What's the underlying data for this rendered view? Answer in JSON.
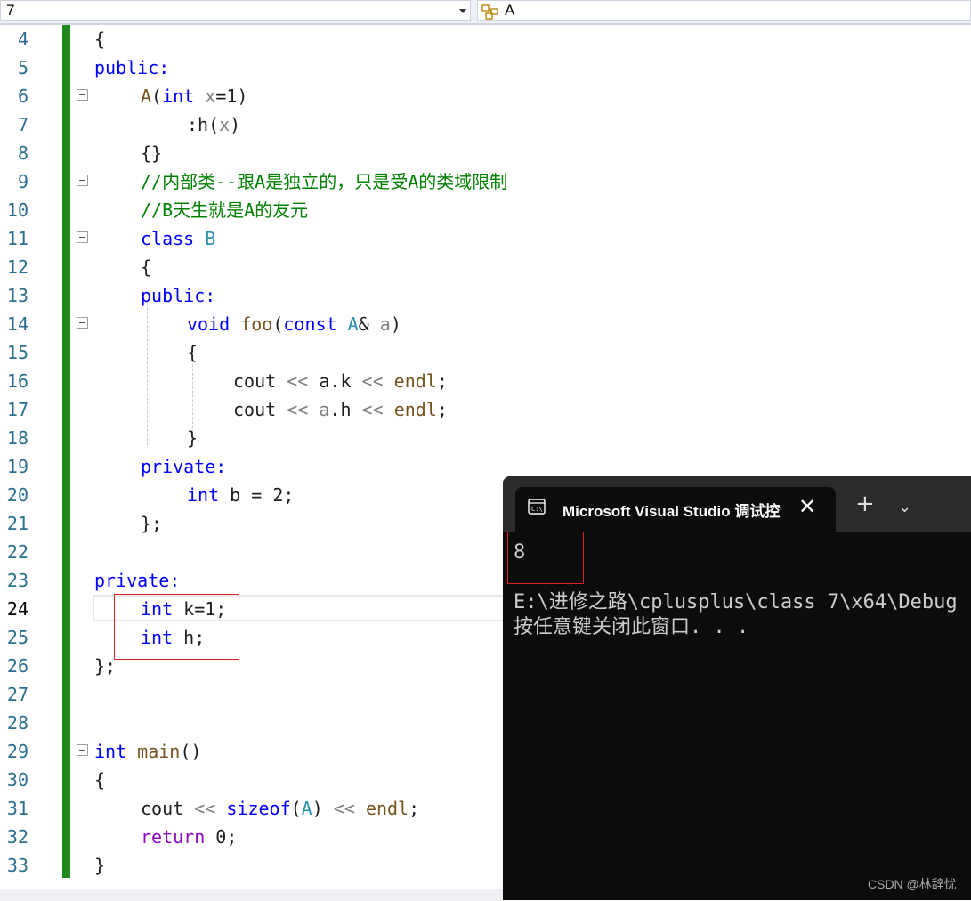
{
  "navbar": {
    "left_dropdown_value": "7",
    "right_dropdown_value": "A",
    "right_icon": "class-icon"
  },
  "editor": {
    "line_numbers": [
      "4",
      "5",
      "6",
      "7",
      "8",
      "9",
      "10",
      "11",
      "12",
      "13",
      "14",
      "15",
      "16",
      "17",
      "18",
      "19",
      "20",
      "21",
      "22",
      "23",
      "24",
      "25",
      "26",
      "27",
      "28",
      "29",
      "30",
      "31",
      "32",
      "33"
    ],
    "lines": {
      "l4": "{",
      "l5": "public:",
      "l6_name": "A",
      "l6_open": "(",
      "l6_kw": "int",
      "l6_param": "x",
      "l6_rest": "=1)",
      "l7_a": ":h(",
      "l7_b": "x",
      "l7_c": ")",
      "l8": "{}",
      "l9": "//内部类--跟A是独立的，只是受A的类域限制",
      "l10": "//B天生就是A的友元",
      "l11_kw": "class",
      "l11_name": "B",
      "l12": "{",
      "l13": "public:",
      "l14_kw": "void",
      "l14_fn": "foo",
      "l14_open": "(",
      "l14_const": "const",
      "l14_type": "A",
      "l14_amp": "&",
      "l14_param": "a",
      "l14_close": ")",
      "l15": "{",
      "l16_a": "cout",
      "l16_b": "<<",
      "l16_c": "a.k",
      "l16_d": "<<",
      "l16_e": "endl",
      "l16_f": ";",
      "l17_a": "cout",
      "l17_b": "<<",
      "l17_c": "a",
      "l17_d": ".h",
      "l17_e": "<<",
      "l17_f": "endl",
      "l17_g": ";",
      "l18": "}",
      "l19": "private:",
      "l20_kw": "int",
      "l20_rest": "b = 2;",
      "l21": "};",
      "l23": "private:",
      "l24_kw": "int",
      "l24_rest": "k=1;",
      "l25_kw": "int",
      "l25_rest": "h;",
      "l26": "};",
      "l29_kw": "int",
      "l29_fn": "main",
      "l29_rest": "()",
      "l30": "{",
      "l31_a": "cout",
      "l31_b": "<<",
      "l31_c": "sizeof",
      "l31_d": "(",
      "l31_e": "A",
      "l31_f": ")",
      "l31_g": "<<",
      "l31_h": "endl",
      "l31_i": ";",
      "l32_kw": "return",
      "l32_rest": "0;",
      "l33": "}"
    }
  },
  "console": {
    "tab_title": "Microsoft Visual Studio 调试控制台",
    "close_glyph": "✕",
    "plus_glyph": "+",
    "caret_glyph": "⌄",
    "output_value": "8",
    "output_path": "E:\\进修之路\\cplusplus\\class 7\\x64\\Debug",
    "output_prompt": "按任意键关闭此窗口. . ."
  },
  "watermark": "CSDN @林辞忧",
  "colors": {
    "change_bar": "#1e8a1e",
    "keyword": "#0000ff",
    "type": "#2b91af",
    "comment": "#008000",
    "highlight_box": "#e02020",
    "console_bg": "#0c0c0c"
  }
}
